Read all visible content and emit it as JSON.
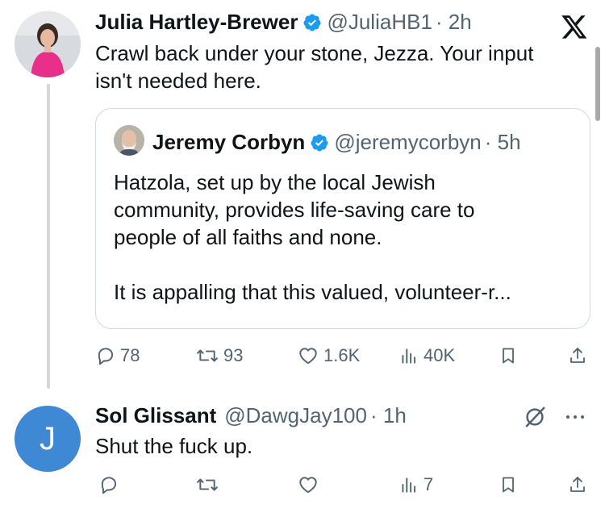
{
  "main_tweet": {
    "name": "Julia Hartley-Brewer",
    "handle": "@JuliaHB1",
    "time": "· 2h",
    "text_line1": "Crawl back under your stone, Jezza. Your input",
    "text_line2": "isn't needed here.",
    "quote": {
      "name": "Jeremy Corbyn",
      "handle": "@jeremycorbyn",
      "time": "· 5h",
      "line1": "Hatzola, set up by the local Jewish",
      "line2": "community, provides life-saving care to",
      "line3": "people of all faiths and none.",
      "line4": "It is appalling that this valued, volunteer-r..."
    },
    "stats": {
      "replies": "78",
      "reposts": "93",
      "likes": "1.6K",
      "views": "40K"
    }
  },
  "reply_tweet": {
    "avatar_letter": "J",
    "name": "Sol Glissant",
    "handle": "@DawgJay100",
    "time": "· 1h",
    "text": "Shut the fuck up.",
    "stats": {
      "views": "7"
    }
  },
  "colors": {
    "verified": "#1d9bf0",
    "secondary_text": "#536471",
    "border": "#cfd9de",
    "avatar_j": "#3f88d4"
  },
  "icons": [
    "x-logo",
    "verified-badge",
    "reply-icon",
    "repost-icon",
    "like-icon",
    "views-icon",
    "bookmark-icon",
    "share-icon",
    "grok-icon",
    "more-icon"
  ]
}
